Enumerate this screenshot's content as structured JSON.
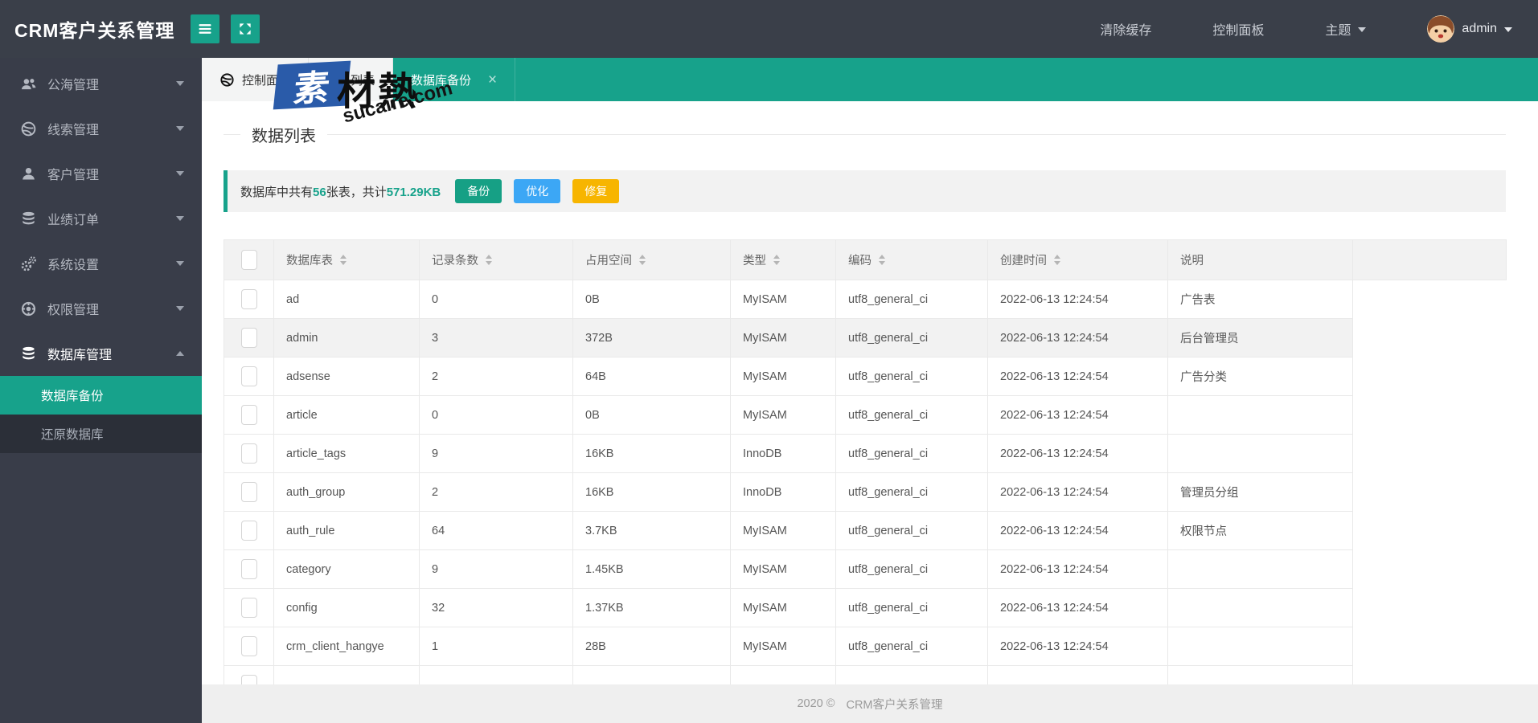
{
  "topbar": {
    "title": "CRM客户关系管理",
    "clear_cache": "清除缓存",
    "dashboard": "控制面板",
    "theme": "主题",
    "username": "admin"
  },
  "sidebar": {
    "items": [
      {
        "label": "公海管理",
        "icon": "users-icon"
      },
      {
        "label": "线索管理",
        "icon": "globe-icon"
      },
      {
        "label": "客户管理",
        "icon": "user-icon"
      },
      {
        "label": "业绩订单",
        "icon": "database-icon"
      },
      {
        "label": "系统设置",
        "icon": "gears-icon"
      },
      {
        "label": "权限管理",
        "icon": "wheel-icon"
      },
      {
        "label": "数据库管理",
        "icon": "database-icon",
        "expanded": true,
        "children": [
          {
            "label": "数据库备份",
            "active": true
          },
          {
            "label": "还原数据库",
            "active": false
          }
        ]
      }
    ]
  },
  "tabs": [
    {
      "label": "控制面板",
      "icon": "globe-icon"
    },
    {
      "label": "会员列表"
    },
    {
      "label": "数据库备份",
      "active": true,
      "closable": true
    }
  ],
  "page": {
    "title": "数据列表",
    "summary": {
      "prefix": "数据库中共有",
      "table_count": "56",
      "middle": "张表，共计",
      "total_size": "571.29KB"
    },
    "buttons": [
      {
        "label": "备份",
        "color": "#16a085"
      },
      {
        "label": "优化",
        "color": "#3ca7f5"
      },
      {
        "label": "修复",
        "color": "#f7b500"
      }
    ]
  },
  "table": {
    "columns": [
      {
        "label": "数据库表",
        "sortable": true
      },
      {
        "label": "记录条数",
        "sortable": true
      },
      {
        "label": "占用空间",
        "sortable": true
      },
      {
        "label": "类型",
        "sortable": true
      },
      {
        "label": "编码",
        "sortable": true
      },
      {
        "label": "创建时间",
        "sortable": true
      },
      {
        "label": "说明",
        "sortable": false
      }
    ],
    "rows": [
      {
        "name": "ad",
        "records": "0",
        "size": "0B",
        "type": "MyISAM",
        "encoding": "utf8_general_ci",
        "created": "2022-06-13 12:24:54",
        "note": "广告表",
        "hovered": false
      },
      {
        "name": "admin",
        "records": "3",
        "size": "372B",
        "type": "MyISAM",
        "encoding": "utf8_general_ci",
        "created": "2022-06-13 12:24:54",
        "note": "后台管理员",
        "hovered": true
      },
      {
        "name": "adsense",
        "records": "2",
        "size": "64B",
        "type": "MyISAM",
        "encoding": "utf8_general_ci",
        "created": "2022-06-13 12:24:54",
        "note": "广告分类",
        "hovered": false
      },
      {
        "name": "article",
        "records": "0",
        "size": "0B",
        "type": "MyISAM",
        "encoding": "utf8_general_ci",
        "created": "2022-06-13 12:24:54",
        "note": "",
        "hovered": false
      },
      {
        "name": "article_tags",
        "records": "9",
        "size": "16KB",
        "type": "InnoDB",
        "encoding": "utf8_general_ci",
        "created": "2022-06-13 12:24:54",
        "note": "",
        "hovered": false
      },
      {
        "name": "auth_group",
        "records": "2",
        "size": "16KB",
        "type": "InnoDB",
        "encoding": "utf8_general_ci",
        "created": "2022-06-13 12:24:54",
        "note": "管理员分组",
        "hovered": false
      },
      {
        "name": "auth_rule",
        "records": "64",
        "size": "3.7KB",
        "type": "MyISAM",
        "encoding": "utf8_general_ci",
        "created": "2022-06-13 12:24:54",
        "note": "权限节点",
        "hovered": false
      },
      {
        "name": "category",
        "records": "9",
        "size": "1.45KB",
        "type": "MyISAM",
        "encoding": "utf8_general_ci",
        "created": "2022-06-13 12:24:54",
        "note": "",
        "hovered": false
      },
      {
        "name": "config",
        "records": "32",
        "size": "1.37KB",
        "type": "MyISAM",
        "encoding": "utf8_general_ci",
        "created": "2022-06-13 12:24:54",
        "note": "",
        "hovered": false
      },
      {
        "name": "crm_client_hangye",
        "records": "1",
        "size": "28B",
        "type": "MyISAM",
        "encoding": "utf8_general_ci",
        "created": "2022-06-13 12:24:54",
        "note": "",
        "hovered": false
      },
      {
        "name": "",
        "records": "",
        "size": "",
        "type": "",
        "encoding": "",
        "created": "",
        "note": "",
        "hovered": false
      }
    ]
  },
  "footer": {
    "year": "2020 ©",
    "brand": "CRM客户关系管理"
  },
  "watermark": {
    "char_white": "素",
    "chars_dark": "材熱",
    "url": "sucaire.com"
  },
  "colors": {
    "header_bg": "#3a3f49",
    "sidebar_bg": "#393d49",
    "accent_teal": "#17a28b",
    "button_backup": "#16a085",
    "button_optimize": "#3ca7f5",
    "button_repair": "#f7b500",
    "submenu_bg": "#2b2f38",
    "table_header_bg": "#f2f2f2",
    "footer_bg": "#efefef"
  }
}
